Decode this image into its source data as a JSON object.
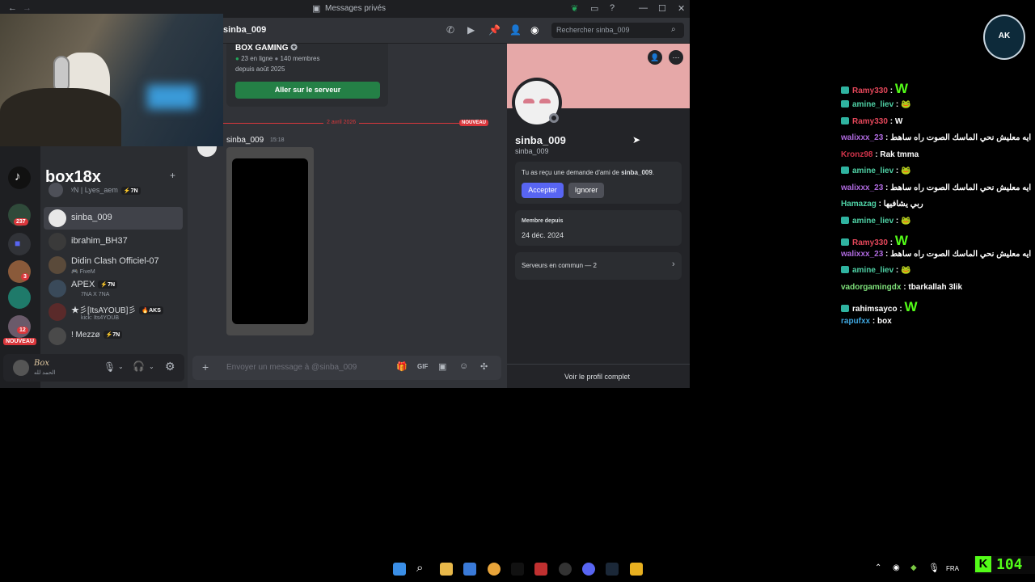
{
  "window": {
    "title": "Messages privés",
    "search_placeholder": "Rechercher sinba_009",
    "header_name": "sinba_009"
  },
  "server_badges": {
    "b1": "237",
    "b2": "3",
    "b3": "12",
    "new": "NOUVEAU"
  },
  "sidebar": {
    "group_title": "box18x",
    "items": [
      {
        "name": "ʸN | Lyes_aem",
        "tag": "⚡7N"
      },
      {
        "name": "sinba_009"
      },
      {
        "name": "ibrahim_BH37"
      },
      {
        "name": "Didin Clash Officiel-07",
        "sub": "FiveM"
      },
      {
        "name": "APEX",
        "tag": "⚡7N",
        "sub": "7NA X 7NA"
      },
      {
        "name": "★彡[ItsAYOUB]彡",
        "tag": "🔥AKS",
        "sub": "kick: Its4YOUB"
      },
      {
        "name": "! Mezzø",
        "tag": "⚡7N"
      }
    ],
    "user_name": "Box",
    "user_status": "الحمد لله"
  },
  "server_invite": {
    "name": "BOX GAMING",
    "online": "23 en ligne",
    "members": "140 membres",
    "since": "depuis août 2025",
    "button": "Aller sur le serveur"
  },
  "messages": {
    "date_divider": "2 avril 2026",
    "new_badge": "NOUVEAU",
    "author": "sinba_009",
    "time": "15:18",
    "input_placeholder": "Envoyer un message à @sinba_009"
  },
  "profile": {
    "display_name": "sinba_009",
    "username": "sinba_009",
    "friend_request_text": "Tu as reçu une demande d'ami de ",
    "friend_request_name": "sinba_009",
    "accept": "Accepter",
    "ignore": "Ignorer",
    "member_since_label": "Membre depuis",
    "member_since": "24 déc. 2024",
    "mutual_servers": "Serveurs en commun — 2",
    "view_full": "Voir le profil complet"
  },
  "stream_chat": [
    {
      "user": "Ramy330",
      "color": "#e4475a",
      "msg": "W",
      "badge": true,
      "big": true
    },
    {
      "user": "amine_liev",
      "color": "#4fd1a5",
      "msg": "🐸",
      "badge": true
    },
    {
      "user": "Ramy330",
      "color": "#e4475a",
      "msg": "W",
      "badge": true
    },
    {
      "user": "walixxx_23",
      "color": "#b06ae0",
      "msg": "ايه معليش نحي الماسك الصوت راه ساهط"
    },
    {
      "user": "Kronz98",
      "color": "#d2344b",
      "msg": "Rak tmma"
    },
    {
      "user": "amine_liev",
      "color": "#4fd1a5",
      "msg": "🐸",
      "badge": true
    },
    {
      "user": "walixxx_23",
      "color": "#b06ae0",
      "msg": "ايه معليش نحي الماسك الصوت راه ساهط"
    },
    {
      "user": "Hamazag",
      "color": "#4fd1a5",
      "msg": "ربي يشافيها"
    },
    {
      "user": "amine_liev",
      "color": "#4fd1a5",
      "msg": "🐸",
      "badge": true
    },
    {
      "user": "Ramy330",
      "color": "#e4475a",
      "msg": "W",
      "badge": true,
      "big": true
    },
    {
      "user": "walixxx_23",
      "color": "#b06ae0",
      "msg": "ايه معليش نحي الماسك الصوت راه ساهط"
    },
    {
      "user": "amine_liev",
      "color": "#4fd1a5",
      "msg": "🐸",
      "badge": true
    },
    {
      "user": "vadorgamingdx",
      "color": "#7ee07a",
      "msg": "tbarkallah 3lik"
    },
    {
      "user": "rahimsayco",
      "color": "#ffffff",
      "msg": "W",
      "badge": true,
      "big": true
    },
    {
      "user": "rapufxx",
      "color": "#3fa7e0",
      "msg": "box"
    }
  ],
  "taskbar": {
    "lang": "FRA",
    "counter": "104"
  },
  "colors": {
    "accent": "#5865f2",
    "green": "#248046",
    "banner": "#e6a8a8",
    "kick": "#53fc18"
  }
}
